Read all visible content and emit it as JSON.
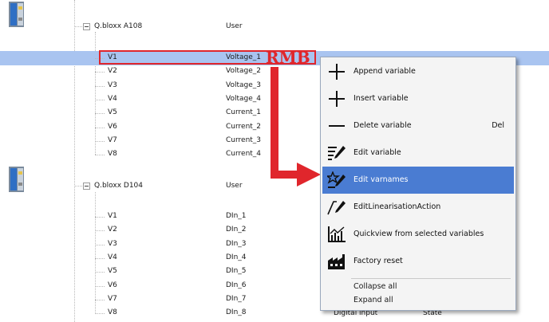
{
  "groups": [
    {
      "name": "Q.bloxx A108",
      "type": "User",
      "rows": [
        {
          "var": "V1",
          "name": "Voltage_1"
        },
        {
          "var": "V2",
          "name": "Voltage_2"
        },
        {
          "var": "V3",
          "name": "Voltage_3"
        },
        {
          "var": "V4",
          "name": "Voltage_4"
        },
        {
          "var": "V5",
          "name": "Current_1"
        },
        {
          "var": "V6",
          "name": "Current_2"
        },
        {
          "var": "V7",
          "name": "Current_3"
        },
        {
          "var": "V8",
          "name": "Current_4"
        }
      ]
    },
    {
      "name": "Q.bloxx D104",
      "type": "User",
      "rows": [
        {
          "var": "V1",
          "name": "DIn_1"
        },
        {
          "var": "V2",
          "name": "DIn_2"
        },
        {
          "var": "V3",
          "name": "DIn_3"
        },
        {
          "var": "V4",
          "name": "DIn_4"
        },
        {
          "var": "V5",
          "name": "DIn_5"
        },
        {
          "var": "V6",
          "name": "DIn_6"
        },
        {
          "var": "V7",
          "name": "DIn_7"
        },
        {
          "var": "V8",
          "name": "DIn_8"
        }
      ],
      "last_row_extra": {
        "type": "Digital input",
        "state": "State"
      }
    }
  ],
  "annotation": {
    "text": "RMB",
    "color": "#e0262c"
  },
  "context_menu": {
    "items": [
      {
        "label": "Append variable",
        "icon": "plus-icon",
        "shortcut": ""
      },
      {
        "label": "Insert variable",
        "icon": "plus-icon",
        "shortcut": ""
      },
      {
        "label": "Delete variable",
        "icon": "minus-icon",
        "shortcut": "Del"
      },
      {
        "label": "Edit variable",
        "icon": "edit-list-icon",
        "shortcut": ""
      },
      {
        "label": "Edit varnames",
        "icon": "edit-star-icon",
        "shortcut": "",
        "highlighted": true
      },
      {
        "label": "EditLinearisationAction",
        "icon": "edit-linear-icon",
        "shortcut": ""
      },
      {
        "label": "Quickview from selected variables",
        "icon": "chart-icon",
        "shortcut": ""
      },
      {
        "label": "Factory reset",
        "icon": "factory-icon",
        "shortcut": ""
      }
    ],
    "bottom_items": [
      {
        "label": "Collapse all"
      },
      {
        "label": "Expand all"
      }
    ]
  },
  "colors": {
    "selection": "#a9c4f0",
    "highlight": "#4a7cd2",
    "accent_red": "#e0262c"
  }
}
